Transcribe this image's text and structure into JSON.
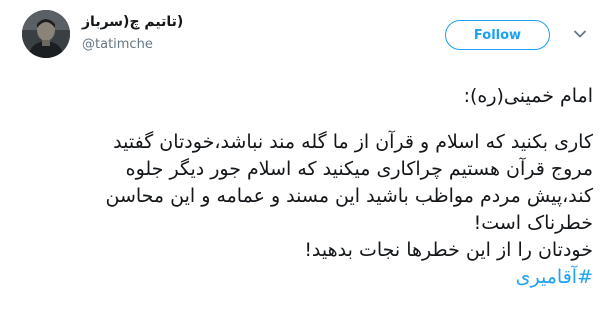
{
  "user": {
    "display_name": "(تاتیم چ(سرباز",
    "handle": "@tatimche"
  },
  "follow_label": "Follow",
  "icons": {
    "avatar": "profile-photo",
    "menu": "chevron-down-icon"
  },
  "colors": {
    "accent": "#1da1f2",
    "text": "#14171a",
    "muted": "#657786"
  },
  "tweet": {
    "line1": "امام خمینی(ره):",
    "line2": "کاری بکنید که اسلام و قرآن از ما گله مند نباشد،خودتان گفتید",
    "line3": "مروج قرآن هستیم چراکاری میکنید که اسلام جور دیگر جلوه",
    "line4": "کند،پیش مردم مواظب باشید این مسند و عمامه و این محاسن",
    "line5": "خطرناک است!",
    "line6": "خودتان را از این خطرها نجات بدهید!",
    "hashtag": "#آقامیری"
  }
}
